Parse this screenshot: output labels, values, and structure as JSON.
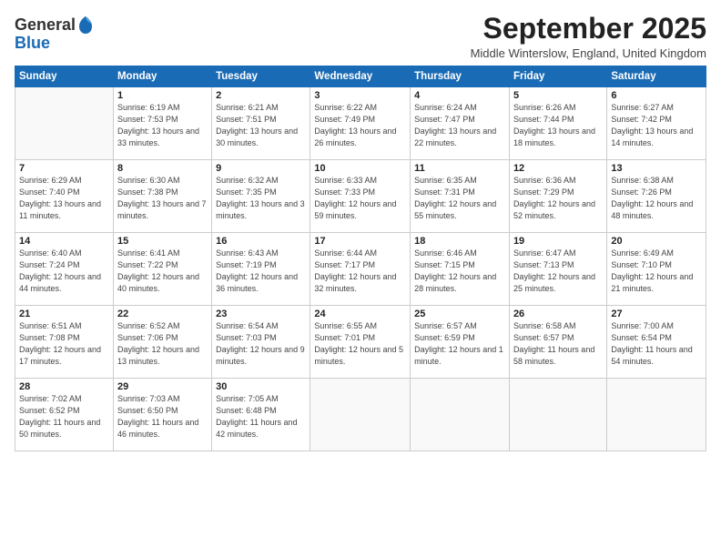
{
  "logo": {
    "general": "General",
    "blue": "Blue"
  },
  "title": "September 2025",
  "location": "Middle Winterslow, England, United Kingdom",
  "weekdays": [
    "Sunday",
    "Monday",
    "Tuesday",
    "Wednesday",
    "Thursday",
    "Friday",
    "Saturday"
  ],
  "weeks": [
    [
      {
        "day": "",
        "sunrise": "",
        "sunset": "",
        "daylight": ""
      },
      {
        "day": "1",
        "sunrise": "Sunrise: 6:19 AM",
        "sunset": "Sunset: 7:53 PM",
        "daylight": "Daylight: 13 hours and 33 minutes."
      },
      {
        "day": "2",
        "sunrise": "Sunrise: 6:21 AM",
        "sunset": "Sunset: 7:51 PM",
        "daylight": "Daylight: 13 hours and 30 minutes."
      },
      {
        "day": "3",
        "sunrise": "Sunrise: 6:22 AM",
        "sunset": "Sunset: 7:49 PM",
        "daylight": "Daylight: 13 hours and 26 minutes."
      },
      {
        "day": "4",
        "sunrise": "Sunrise: 6:24 AM",
        "sunset": "Sunset: 7:47 PM",
        "daylight": "Daylight: 13 hours and 22 minutes."
      },
      {
        "day": "5",
        "sunrise": "Sunrise: 6:26 AM",
        "sunset": "Sunset: 7:44 PM",
        "daylight": "Daylight: 13 hours and 18 minutes."
      },
      {
        "day": "6",
        "sunrise": "Sunrise: 6:27 AM",
        "sunset": "Sunset: 7:42 PM",
        "daylight": "Daylight: 13 hours and 14 minutes."
      }
    ],
    [
      {
        "day": "7",
        "sunrise": "Sunrise: 6:29 AM",
        "sunset": "Sunset: 7:40 PM",
        "daylight": "Daylight: 13 hours and 11 minutes."
      },
      {
        "day": "8",
        "sunrise": "Sunrise: 6:30 AM",
        "sunset": "Sunset: 7:38 PM",
        "daylight": "Daylight: 13 hours and 7 minutes."
      },
      {
        "day": "9",
        "sunrise": "Sunrise: 6:32 AM",
        "sunset": "Sunset: 7:35 PM",
        "daylight": "Daylight: 13 hours and 3 minutes."
      },
      {
        "day": "10",
        "sunrise": "Sunrise: 6:33 AM",
        "sunset": "Sunset: 7:33 PM",
        "daylight": "Daylight: 12 hours and 59 minutes."
      },
      {
        "day": "11",
        "sunrise": "Sunrise: 6:35 AM",
        "sunset": "Sunset: 7:31 PM",
        "daylight": "Daylight: 12 hours and 55 minutes."
      },
      {
        "day": "12",
        "sunrise": "Sunrise: 6:36 AM",
        "sunset": "Sunset: 7:29 PM",
        "daylight": "Daylight: 12 hours and 52 minutes."
      },
      {
        "day": "13",
        "sunrise": "Sunrise: 6:38 AM",
        "sunset": "Sunset: 7:26 PM",
        "daylight": "Daylight: 12 hours and 48 minutes."
      }
    ],
    [
      {
        "day": "14",
        "sunrise": "Sunrise: 6:40 AM",
        "sunset": "Sunset: 7:24 PM",
        "daylight": "Daylight: 12 hours and 44 minutes."
      },
      {
        "day": "15",
        "sunrise": "Sunrise: 6:41 AM",
        "sunset": "Sunset: 7:22 PM",
        "daylight": "Daylight: 12 hours and 40 minutes."
      },
      {
        "day": "16",
        "sunrise": "Sunrise: 6:43 AM",
        "sunset": "Sunset: 7:19 PM",
        "daylight": "Daylight: 12 hours and 36 minutes."
      },
      {
        "day": "17",
        "sunrise": "Sunrise: 6:44 AM",
        "sunset": "Sunset: 7:17 PM",
        "daylight": "Daylight: 12 hours and 32 minutes."
      },
      {
        "day": "18",
        "sunrise": "Sunrise: 6:46 AM",
        "sunset": "Sunset: 7:15 PM",
        "daylight": "Daylight: 12 hours and 28 minutes."
      },
      {
        "day": "19",
        "sunrise": "Sunrise: 6:47 AM",
        "sunset": "Sunset: 7:13 PM",
        "daylight": "Daylight: 12 hours and 25 minutes."
      },
      {
        "day": "20",
        "sunrise": "Sunrise: 6:49 AM",
        "sunset": "Sunset: 7:10 PM",
        "daylight": "Daylight: 12 hours and 21 minutes."
      }
    ],
    [
      {
        "day": "21",
        "sunrise": "Sunrise: 6:51 AM",
        "sunset": "Sunset: 7:08 PM",
        "daylight": "Daylight: 12 hours and 17 minutes."
      },
      {
        "day": "22",
        "sunrise": "Sunrise: 6:52 AM",
        "sunset": "Sunset: 7:06 PM",
        "daylight": "Daylight: 12 hours and 13 minutes."
      },
      {
        "day": "23",
        "sunrise": "Sunrise: 6:54 AM",
        "sunset": "Sunset: 7:03 PM",
        "daylight": "Daylight: 12 hours and 9 minutes."
      },
      {
        "day": "24",
        "sunrise": "Sunrise: 6:55 AM",
        "sunset": "Sunset: 7:01 PM",
        "daylight": "Daylight: 12 hours and 5 minutes."
      },
      {
        "day": "25",
        "sunrise": "Sunrise: 6:57 AM",
        "sunset": "Sunset: 6:59 PM",
        "daylight": "Daylight: 12 hours and 1 minute."
      },
      {
        "day": "26",
        "sunrise": "Sunrise: 6:58 AM",
        "sunset": "Sunset: 6:57 PM",
        "daylight": "Daylight: 11 hours and 58 minutes."
      },
      {
        "day": "27",
        "sunrise": "Sunrise: 7:00 AM",
        "sunset": "Sunset: 6:54 PM",
        "daylight": "Daylight: 11 hours and 54 minutes."
      }
    ],
    [
      {
        "day": "28",
        "sunrise": "Sunrise: 7:02 AM",
        "sunset": "Sunset: 6:52 PM",
        "daylight": "Daylight: 11 hours and 50 minutes."
      },
      {
        "day": "29",
        "sunrise": "Sunrise: 7:03 AM",
        "sunset": "Sunset: 6:50 PM",
        "daylight": "Daylight: 11 hours and 46 minutes."
      },
      {
        "day": "30",
        "sunrise": "Sunrise: 7:05 AM",
        "sunset": "Sunset: 6:48 PM",
        "daylight": "Daylight: 11 hours and 42 minutes."
      },
      {
        "day": "",
        "sunrise": "",
        "sunset": "",
        "daylight": ""
      },
      {
        "day": "",
        "sunrise": "",
        "sunset": "",
        "daylight": ""
      },
      {
        "day": "",
        "sunrise": "",
        "sunset": "",
        "daylight": ""
      },
      {
        "day": "",
        "sunrise": "",
        "sunset": "",
        "daylight": ""
      }
    ]
  ]
}
